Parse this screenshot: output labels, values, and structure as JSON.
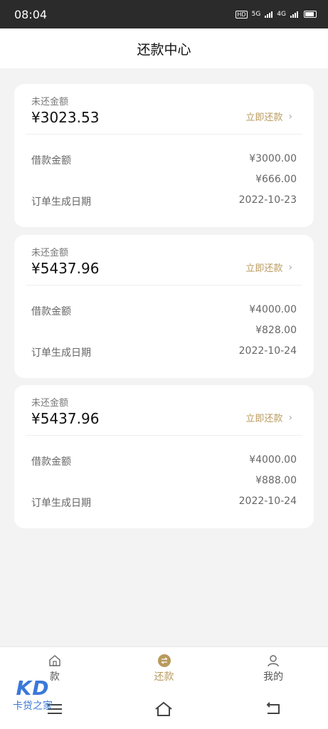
{
  "status_bar": {
    "time": "08:04",
    "net1": "5G",
    "net2": "4G",
    "hd": "HD"
  },
  "header": {
    "title": "还款中心"
  },
  "labels": {
    "unpaid": "未还金额",
    "repay_now": "立即还款",
    "loan_amount": "借款金额",
    "order_date": "订单生成日期"
  },
  "loans": [
    {
      "unpaid_amount": "¥3023.53",
      "loan_amount": "¥3000.00",
      "extra_amount": "¥666.00",
      "order_date": "2022-10-23"
    },
    {
      "unpaid_amount": "¥5437.96",
      "loan_amount": "¥4000.00",
      "extra_amount": "¥828.00",
      "order_date": "2022-10-24"
    },
    {
      "unpaid_amount": "¥5437.96",
      "loan_amount": "¥4000.00",
      "extra_amount": "¥888.00",
      "order_date": "2022-10-24"
    }
  ],
  "tabs": [
    {
      "label": "款",
      "icon": "home-icon"
    },
    {
      "label": "还款",
      "icon": "repay-icon",
      "active": true
    },
    {
      "label": "我的",
      "icon": "profile-icon"
    }
  ],
  "watermark": {
    "logo": "KD",
    "text": "卡贷之家"
  },
  "colors": {
    "accent": "#b89a5c",
    "status_bar": "#2b2b2b",
    "background": "#f3f3f3"
  }
}
